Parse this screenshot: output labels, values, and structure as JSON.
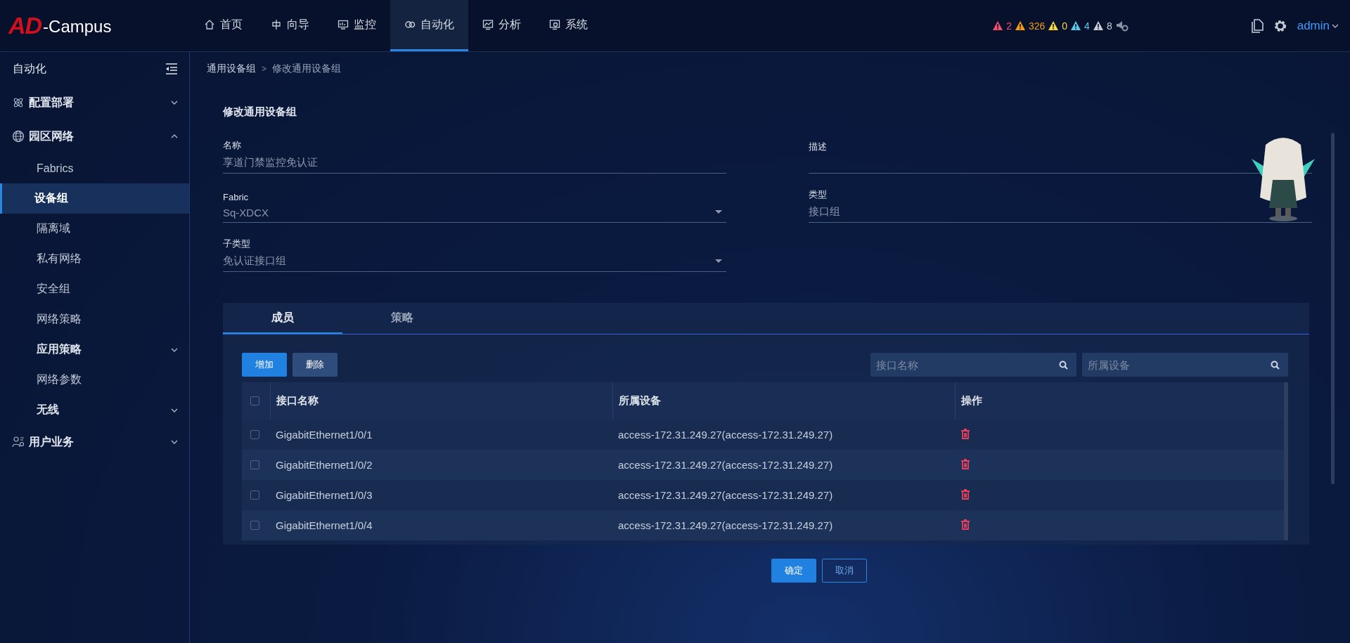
{
  "logo": {
    "mark": "AD",
    "text": "-Campus"
  },
  "nav": [
    {
      "label": "首页",
      "selected": false
    },
    {
      "label": "向导",
      "selected": false
    },
    {
      "label": "监控",
      "selected": false
    },
    {
      "label": "自动化",
      "selected": true
    },
    {
      "label": "分析",
      "selected": false
    },
    {
      "label": "系统",
      "selected": false
    }
  ],
  "alerts": [
    {
      "count": "2",
      "color": "#f0506e"
    },
    {
      "count": "326",
      "color": "#f39c12"
    },
    {
      "count": "0",
      "color": "#f5d742"
    },
    {
      "count": "4",
      "color": "#5bc8e8"
    },
    {
      "count": "8",
      "color": "#c8ccd4"
    }
  ],
  "user": {
    "name": "admin"
  },
  "sidebar": {
    "title": "自动化",
    "items": [
      {
        "label": "配置部署",
        "expanded": false
      },
      {
        "label": "园区网络",
        "expanded": true,
        "children": [
          {
            "label": "Fabrics",
            "selected": false
          },
          {
            "label": "设备组",
            "selected": true
          },
          {
            "label": "隔离域",
            "selected": false
          },
          {
            "label": "私有网络",
            "selected": false
          },
          {
            "label": "安全组",
            "selected": false
          },
          {
            "label": "网络策略",
            "selected": false
          },
          {
            "label": "应用策略",
            "selected": false,
            "expanded": false
          },
          {
            "label": "网络参数",
            "selected": false
          },
          {
            "label": "无线",
            "selected": false,
            "expanded": false
          }
        ]
      },
      {
        "label": "用户业务",
        "expanded": false
      }
    ]
  },
  "breadcrumb": [
    "通用设备组",
    "修改通用设备组"
  ],
  "breadcrumb_separator": ">",
  "form": {
    "title": "修改通用设备组",
    "fields": [
      {
        "label": "名称",
        "value": "享道门禁监控免认证",
        "kind": "text"
      },
      {
        "label": "描述",
        "kind": "text"
      },
      {
        "label": "Fabric",
        "value": "Sq-XDCX",
        "kind": "select"
      },
      {
        "label": "类型",
        "value": "接口组",
        "kind": "text"
      },
      {
        "label": "子类型",
        "value": "免认证接口组",
        "kind": "select"
      }
    ]
  },
  "tabs": [
    {
      "label": "成员",
      "selected": true
    },
    {
      "label": "策略",
      "selected": false
    }
  ],
  "toolbar": {
    "buttons": [
      {
        "label": "增加",
        "kind": "primary"
      },
      {
        "label": "删除",
        "kind": "secondary"
      }
    ],
    "searches": [
      {
        "placeholder": "接口名称"
      },
      {
        "placeholder": "所属设备"
      }
    ]
  },
  "table": {
    "all_checked": false,
    "columns": [
      "接口名称",
      "所属设备",
      "操作"
    ],
    "rows": [
      {
        "checked": false,
        "interface": "GigabitEthernet1/0/1",
        "device": "access-172.31.249.27(access-172.31.249.27)"
      },
      {
        "checked": false,
        "interface": "GigabitEthernet1/0/2",
        "device": "access-172.31.249.27(access-172.31.249.27)"
      },
      {
        "checked": false,
        "interface": "GigabitEthernet1/0/3",
        "device": "access-172.31.249.27(access-172.31.249.27)"
      },
      {
        "checked": false,
        "interface": "GigabitEthernet1/0/4",
        "device": "access-172.31.249.27(access-172.31.249.27)"
      }
    ]
  },
  "actions": [
    {
      "label": "确定",
      "kind": "primary"
    },
    {
      "label": "取消",
      "kind": "outline"
    }
  ]
}
